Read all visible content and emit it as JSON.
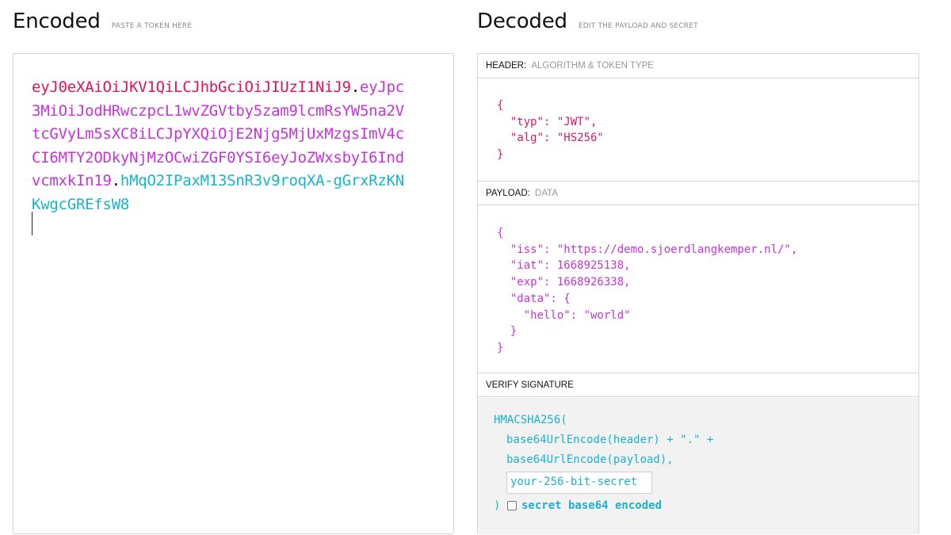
{
  "encoded": {
    "title": "Encoded",
    "subtitle": "PASTE A TOKEN HERE",
    "token_header": "eyJ0eXAiOiJKV1QiLCJhbGciOiJIUzI1NiJ9",
    "token_payload": "eyJpc3MiOiJodHRwczpcL1wvZGVtby5zam9lcmRsYW5na2VtcGVyLm5sXC8iLCJpYXQiOjE2Njg5MjUxMzgsImV4cCI6MTY2ODkyNjMzOCwiZGF0YSI6eyJoZWxsbyI6IndvcmxkIn19",
    "token_signature": "hMqO2IPaxM13SnR3v9roqXA-gGrxRzKNKwgcGREfsW8",
    "dot": "."
  },
  "decoded": {
    "title": "Decoded",
    "subtitle": "EDIT THE PAYLOAD AND SECRET",
    "header_section": {
      "label": "HEADER:",
      "sublabel": "ALGORITHM & TOKEN TYPE"
    },
    "header_json": "{\n  \"typ\": \"JWT\",\n  \"alg\": \"HS256\"\n}",
    "payload_section": {
      "label": "PAYLOAD:",
      "sublabel": "DATA"
    },
    "payload_json": "{\n  \"iss\": \"https://demo.sjoerdlangkemper.nl/\",\n  \"iat\": 1668925138,\n  \"exp\": 1668926338,\n  \"data\": {\n    \"hello\": \"world\"\n  }\n}",
    "verify_section": {
      "label": "VERIFY SIGNATURE"
    },
    "verify": {
      "line1": "HMACSHA256(",
      "line2": "base64UrlEncode(header) + \".\" +",
      "line3": "base64UrlEncode(payload),",
      "secret_placeholder": "your-256-bit-secret",
      "close_paren": ")",
      "checkbox_label": "secret base64 encoded",
      "checkbox_checked": false
    }
  },
  "colors": {
    "header": "#e0125a",
    "payload": "#c435d8",
    "signature": "#19b3cc"
  }
}
